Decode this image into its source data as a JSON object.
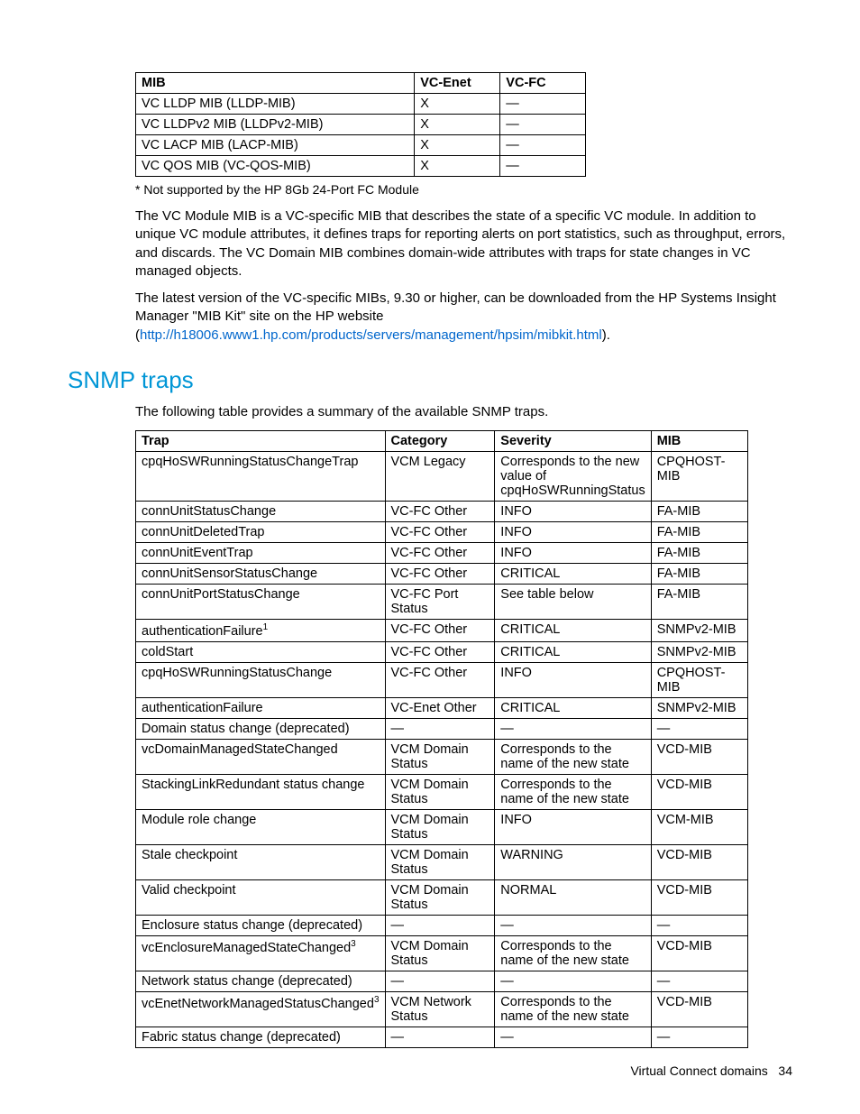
{
  "mib_table": {
    "headers": [
      "MIB",
      "VC-Enet",
      "VC-FC"
    ],
    "rows": [
      [
        "VC LLDP MIB (LLDP-MIB)",
        "X",
        "—"
      ],
      [
        "VC LLDPv2 MIB (LLDPv2-MIB)",
        "X",
        "—"
      ],
      [
        "VC LACP MIB (LACP-MIB)",
        "X",
        "—"
      ],
      [
        "VC QOS MIB (VC-QOS-MIB)",
        "X",
        "—"
      ]
    ]
  },
  "footnote": "* Not supported by the HP 8Gb 24-Port FC Module",
  "para1": "The VC Module MIB is a VC-specific MIB that describes the state of a specific VC module. In addition to unique VC module attributes, it defines traps for reporting alerts on port statistics, such as throughput, errors, and discards. The VC Domain MIB combines domain-wide attributes with traps for state changes in VC managed objects.",
  "para2_pre": "The latest version of the VC-specific MIBs, 9.30 or higher, can be downloaded from the HP Systems Insight Manager \"MIB Kit\" site on the HP website (",
  "para2_link": "http://h18006.www1.hp.com/products/servers/management/hpsim/mibkit.html",
  "para2_post": ").",
  "section_heading": "SNMP traps",
  "section_intro": "The following table provides a summary of the available SNMP traps.",
  "trap_table": {
    "headers": [
      "Trap",
      "Category",
      "Severity",
      "MIB"
    ],
    "rows": [
      {
        "trap": "cpqHoSWRunningStatusChangeTrap",
        "sup": "",
        "cat": "VCM Legacy",
        "sev": "Corresponds to the new value of cpqHoSWRunningStatus",
        "mib": "CPQHOST-MIB"
      },
      {
        "trap": "connUnitStatusChange",
        "sup": "",
        "cat": "VC-FC Other",
        "sev": "INFO",
        "mib": "FA-MIB"
      },
      {
        "trap": "connUnitDeletedTrap",
        "sup": "",
        "cat": "VC-FC Other",
        "sev": "INFO",
        "mib": "FA-MIB"
      },
      {
        "trap": "connUnitEventTrap",
        "sup": "",
        "cat": "VC-FC Other",
        "sev": "INFO",
        "mib": "FA-MIB"
      },
      {
        "trap": "connUnitSensorStatusChange",
        "sup": "",
        "cat": "VC-FC Other",
        "sev": "CRITICAL",
        "mib": "FA-MIB"
      },
      {
        "trap": "connUnitPortStatusChange",
        "sup": "",
        "cat": "VC-FC Port Status",
        "sev": "See table below",
        "mib": "FA-MIB"
      },
      {
        "trap": "authenticationFailure",
        "sup": "1",
        "cat": "VC-FC Other",
        "sev": "CRITICAL",
        "mib": "SNMPv2-MIB"
      },
      {
        "trap": "coldStart",
        "sup": "",
        "cat": "VC-FC Other",
        "sev": "CRITICAL",
        "mib": "SNMPv2-MIB"
      },
      {
        "trap": "cpqHoSWRunningStatusChange",
        "sup": "",
        "cat": "VC-FC Other",
        "sev": "INFO",
        "mib": "CPQHOST-MIB"
      },
      {
        "trap": "authenticationFailure",
        "sup": "",
        "cat": "VC-Enet Other",
        "sev": "CRITICAL",
        "mib": "SNMPv2-MIB"
      },
      {
        "trap": "Domain status change (deprecated)",
        "sup": "",
        "cat": "—",
        "sev": "—",
        "mib": "—"
      },
      {
        "trap": "vcDomainManagedStateChanged",
        "sup": "",
        "cat": "VCM Domain Status",
        "sev": "Corresponds to the name of the new state",
        "mib": "VCD-MIB"
      },
      {
        "trap": "StackingLinkRedundant status change",
        "sup": "",
        "cat": "VCM Domain Status",
        "sev": "Corresponds to the name of the new state",
        "mib": "VCD-MIB"
      },
      {
        "trap": "Module role change",
        "sup": "",
        "cat": "VCM Domain Status",
        "sev": "INFO",
        "mib": "VCM-MIB"
      },
      {
        "trap": "Stale checkpoint",
        "sup": "",
        "cat": "VCM Domain Status",
        "sev": "WARNING",
        "mib": "VCD-MIB"
      },
      {
        "trap": "Valid checkpoint",
        "sup": "",
        "cat": "VCM Domain Status",
        "sev": "NORMAL",
        "mib": "VCD-MIB"
      },
      {
        "trap": "Enclosure status change (deprecated)",
        "sup": "",
        "cat": "—",
        "sev": "—",
        "mib": "—"
      },
      {
        "trap": "vcEnclosureManagedStateChanged",
        "sup": "3",
        "cat": "VCM Domain Status",
        "sev": "Corresponds to the name of the new state",
        "mib": "VCD-MIB"
      },
      {
        "trap": "Network status change (deprecated)",
        "sup": "",
        "cat": "—",
        "sev": "—",
        "mib": "—"
      },
      {
        "trap": "vcEnetNetworkManagedStatusChanged",
        "sup": "3",
        "cat": "VCM Network Status",
        "sev": "Corresponds to the name of the new state",
        "mib": "VCD-MIB"
      },
      {
        "trap": "Fabric status change (deprecated)",
        "sup": "",
        "cat": "—",
        "sev": "—",
        "mib": "—"
      }
    ]
  },
  "footer_text": "Virtual Connect domains",
  "footer_page": "34"
}
